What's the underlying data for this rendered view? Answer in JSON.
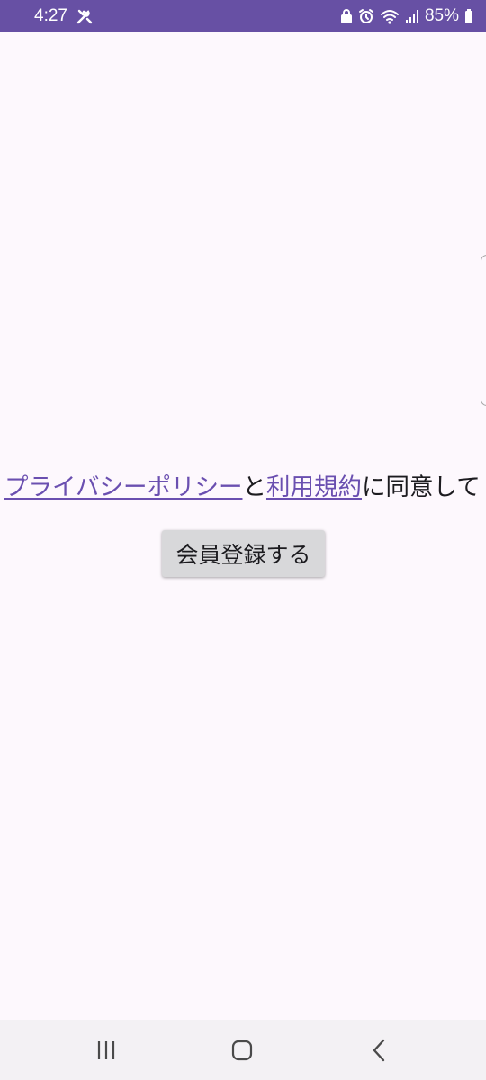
{
  "status_bar": {
    "time": "4:27",
    "battery": "85%",
    "icons": [
      "tools-icon",
      "lock-icon",
      "alarm-icon",
      "wifi-icon",
      "signal-icon",
      "battery-icon"
    ]
  },
  "consent": {
    "privacy_link": "プライバシーポリシー",
    "conjunction": "と",
    "terms_link": "利用規約",
    "suffix": "に同意して"
  },
  "register_button": {
    "label": "会員登録する"
  },
  "nav_bar": {
    "buttons": [
      "recent-apps-icon",
      "home-icon",
      "back-icon"
    ]
  },
  "colors": {
    "status_bar": "#6750a4",
    "link": "#6a4fb0",
    "background": "#fdf8fd",
    "button": "#d8d8da"
  }
}
